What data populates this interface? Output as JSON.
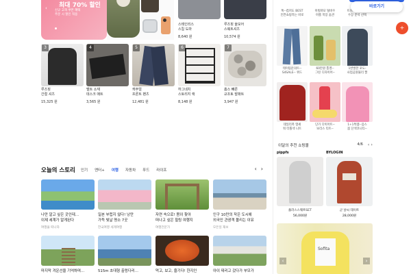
{
  "banner": {
    "headline": "최대 70% 할인",
    "sub1": "신규 고객 쿠폰 혜택",
    "sub2": "주문 시 할인 적용"
  },
  "top_products": [
    {
      "name_line1": "스테인리스",
      "name_line2": "스킬 도마",
      "price": "8,640 원"
    },
    {
      "name_line1": "루즈핏 울모어",
      "name_line2": "스웨트셔츠",
      "price": "10,574 원"
    }
  ],
  "ranked_products": [
    {
      "rank": "3",
      "name_line1": "루즈핏",
      "name_line2": "간절 셔츠",
      "price": "15,325 원"
    },
    {
      "rank": "4",
      "name_line1": "벨트 소재",
      "name_line2": "데스크 매트",
      "price": "3,565 원"
    },
    {
      "rank": "5",
      "name_line1": "캐주얼",
      "name_line2": "프론트 팬츠",
      "price": "12,481 원"
    },
    {
      "rank": "6",
      "name_line1": "하그네치",
      "name_line2": "스토리지 랙",
      "price": "8,148 원"
    },
    {
      "rank": "7",
      "name_line1": "홈스 빼른",
      "name_line2": "규조토 발매트",
      "price": "3,947 원"
    }
  ],
  "story": {
    "title": "오늘의 스토리",
    "tabs": [
      "인기",
      "엔터+",
      "여행",
      "자동차",
      "푸드",
      "라이프"
    ],
    "active_tab": "여행",
    "prev": "‹",
    "next": "›",
    "items": [
      {
        "line1": "나만 알고 싶은 곳인데…",
        "line2": "이제 세계가 알게된다",
        "source": "여행을 떠나자"
      },
      {
        "line1": "일본 부럽지 않다! 낭만",
        "line2": "가득 빛날 명소 7곳",
        "source": "한국여행 세계여행"
      },
      {
        "line1": "자연 속으로! 봄이 찾아",
        "line2": "떠나고 싶은 힐링 여행지",
        "source": "여행전문가"
      },
      {
        "line1": "인구 10만의 작은 도시에",
        "line2": "외국인 관광객 몰리는 이유",
        "source": "모든일 재보"
      },
      {
        "line1": "마지막 겨운선을 기억하며…",
        "line2": "",
        "source": ""
      },
      {
        "line1": "515m 초대형 출렁다리…",
        "line2": "",
        "source": ""
      },
      {
        "line1": "먹고, 보고, 즐기다! 한지인",
        "line2": "",
        "source": ""
      },
      {
        "line1": "아이 데리고 갔다가 부모가",
        "line2": "",
        "source": ""
      }
    ]
  },
  "right_top": [
    {
      "line1": "톡--컴지도 BEST",
      "line2": "인연쇼핑하는 바로"
    },
    {
      "line1": "아킬까모 털비수",
      "line2": "아를 목장 숨관"
    },
    {
      "line1": "트렌디 수입업체",
      "line2": "수장 분석 선택"
    }
  ],
  "right_grid": [
    {
      "line1": "테이핑운의트--",
      "line2": "S4SALE-- 위드"
    },
    {
      "line1": "60만원 통영--",
      "line2": "그린 디자이어--"
    },
    {
      "line1": "1번발한 포도-",
      "line2": "사업공원물리 팔"
    },
    {
      "line1": "데일리폭 맹세",
      "line2": "워 터틀넥 니트"
    },
    {
      "line1": "단가 다이어트--",
      "line2": "보리스 티트--"
    },
    {
      "line1": "1+1특템--응스",
      "line2": "봄 단색코니티--"
    }
  ],
  "reco": {
    "title": "이달의 추천 쇼핑몰",
    "page": "4/6",
    "prev": "‹",
    "next": "›",
    "cards": [
      {
        "brand": "pippfs",
        "name": "플러스스웨트SET",
        "price": "56,000원"
      },
      {
        "brand": "BYLOGIN",
        "name": "군 날씨 테이트",
        "price": "28,000원"
      }
    ]
  },
  "big_ad": {
    "prev": "‹",
    "next": "›",
    "sign": "Sofita"
  },
  "float": {
    "label": "바로가기",
    "badge": "+"
  }
}
